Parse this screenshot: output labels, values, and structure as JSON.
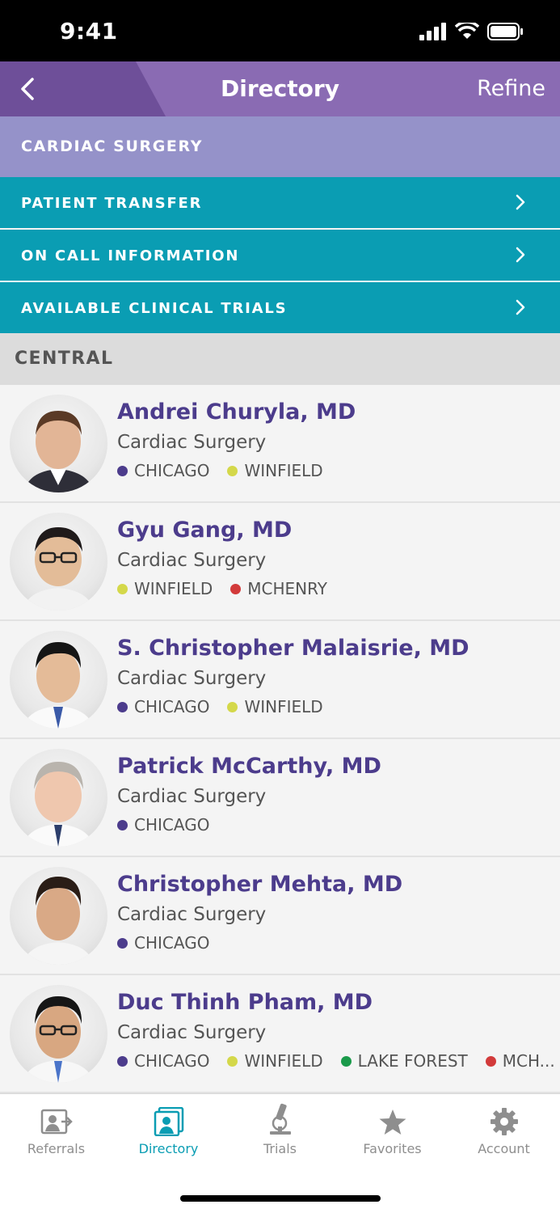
{
  "status_bar": {
    "time": "9:41"
  },
  "nav": {
    "title": "Directory",
    "refine_label": "Refine"
  },
  "specialty": "CARDIAC SURGERY",
  "menu_rows": [
    {
      "label": "PATIENT TRANSFER"
    },
    {
      "label": "ON CALL INFORMATION"
    },
    {
      "label": "AVAILABLE CLINICAL TRIALS"
    }
  ],
  "section": {
    "title": "CENTRAL"
  },
  "doctors": [
    {
      "name": "Andrei Churyla, MD",
      "specialty": "Cardiac Surgery",
      "locations": [
        {
          "label": "CHICAGO",
          "color": "#4c3c8c"
        },
        {
          "label": "WINFIELD",
          "color": "#d4d84a"
        }
      ]
    },
    {
      "name": "Gyu Gang, MD",
      "specialty": "Cardiac Surgery",
      "locations": [
        {
          "label": "WINFIELD",
          "color": "#d4d84a"
        },
        {
          "label": "MCHENRY",
          "color": "#d23a3a"
        }
      ]
    },
    {
      "name": "S. Christopher Malaisrie, MD",
      "specialty": "Cardiac Surgery",
      "locations": [
        {
          "label": "CHICAGO",
          "color": "#4c3c8c"
        },
        {
          "label": "WINFIELD",
          "color": "#d4d84a"
        }
      ]
    },
    {
      "name": "Patrick McCarthy, MD",
      "specialty": "Cardiac Surgery",
      "locations": [
        {
          "label": "CHICAGO",
          "color": "#4c3c8c"
        }
      ]
    },
    {
      "name": "Christopher Mehta, MD",
      "specialty": "Cardiac Surgery",
      "locations": [
        {
          "label": "CHICAGO",
          "color": "#4c3c8c"
        }
      ]
    },
    {
      "name": "Duc Thinh Pham, MD",
      "specialty": "Cardiac Surgery",
      "locations": [
        {
          "label": "CHICAGO",
          "color": "#4c3c8c"
        },
        {
          "label": "WINFIELD",
          "color": "#d4d84a"
        },
        {
          "label": "LAKE FOREST",
          "color": "#1a9a4a"
        },
        {
          "label": "MCH...",
          "color": "#d23a3a"
        }
      ]
    }
  ],
  "tabs": [
    {
      "label": "Referrals",
      "icon": "referrals-icon"
    },
    {
      "label": "Directory",
      "icon": "directory-icon",
      "active": true
    },
    {
      "label": "Trials",
      "icon": "microscope-icon"
    },
    {
      "label": "Favorites",
      "icon": "star-icon"
    },
    {
      "label": "Account",
      "icon": "gear-icon"
    }
  ],
  "colors": {
    "purple_dark": "#6e4f99",
    "purple": "#8a6bb3",
    "lavender": "#9592c9",
    "teal": "#0a9db3",
    "name_purple": "#4c3c8c"
  }
}
